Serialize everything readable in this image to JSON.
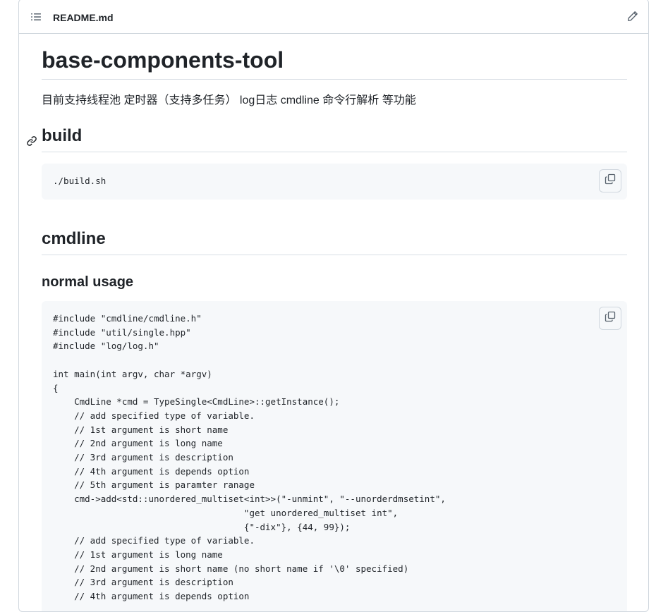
{
  "header": {
    "file_name": "README.md",
    "toc_icon": "list-unordered-icon",
    "edit_icon": "pencil-icon"
  },
  "readme": {
    "title": "base-components-tool",
    "description": "目前支持线程池 定时器（支持多任务） log日志 cmdline 命令行解析 等功能",
    "build_heading": "build",
    "build_code": "./build.sh",
    "cmdline_heading": "cmdline",
    "usage_heading": "normal usage",
    "usage_code": "#include \"cmdline/cmdline.h\"\n#include \"util/single.hpp\"\n#include \"log/log.h\"\n\nint main(int argv, char *argv)\n{\n    CmdLine *cmd = TypeSingle<CmdLine>::getInstance();\n    // add specified type of variable.\n    // 1st argument is short name\n    // 2nd argument is long name\n    // 3rd argument is description\n    // 4th argument is depends option\n    // 5th argument is paramter ranage\n    cmd->add<std::unordered_multiset<int>>(\"-unmint\", \"--unorderdmsetint\",\n                                    \"get unordered_multiset int\",\n                                    {\"-dix\"}, {44, 99});\n    // add specified type of variable.\n    // 1st argument is long name\n    // 2nd argument is short name (no short name if '\\0' specified)\n    // 3rd argument is description\n    // 4th argument is depends option"
  },
  "icons": {
    "anchor": "link-icon",
    "copy": "copy-icon"
  }
}
